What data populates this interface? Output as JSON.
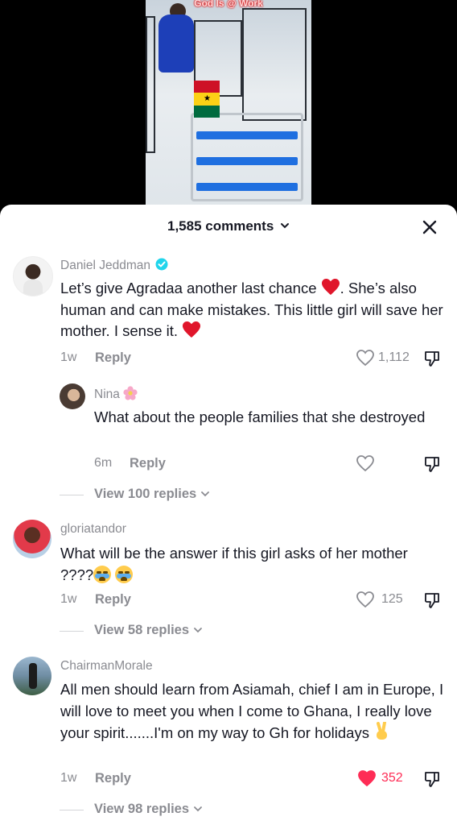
{
  "video": {
    "overlay_text": "God Is @ Work",
    "flag_colors": [
      "#ce1126",
      "#fcd116",
      "#006b3f"
    ]
  },
  "sheet": {
    "comment_count": "1,585 comments",
    "accent_like": "#fe2c55"
  },
  "comments": [
    {
      "username": "Daniel Jeddman",
      "verified": true,
      "text_a": "Let’s give Agradaa another last chance",
      "text_b": ". She’s also human and can make mistakes. This little girl will save her mother. I sense it.",
      "time": "1w",
      "reply_label": "Reply",
      "likes": "1,112"
    },
    {
      "username": "Nina",
      "text": "What about the people families that she destroyed",
      "time": "6m",
      "reply_label": "Reply",
      "likes": ""
    },
    {
      "view_replies": "View 100 replies"
    },
    {
      "username": "gloriatandor",
      "text": "What will be the answer if this girl asks of her mother ????",
      "time": "1w",
      "reply_label": "Reply",
      "likes": "125",
      "view_replies": "View 58 replies"
    },
    {
      "username": "ChairmanMorale",
      "text": "All men should learn from Asiamah, chief I am in Europe, I will love to meet you when I come to Ghana, I really love your spirit.......I'm on my way to Gh for holidays",
      "time": "1w",
      "reply_label": "Reply",
      "likes": "352",
      "liked": true,
      "view_replies": "View 98 replies"
    }
  ]
}
